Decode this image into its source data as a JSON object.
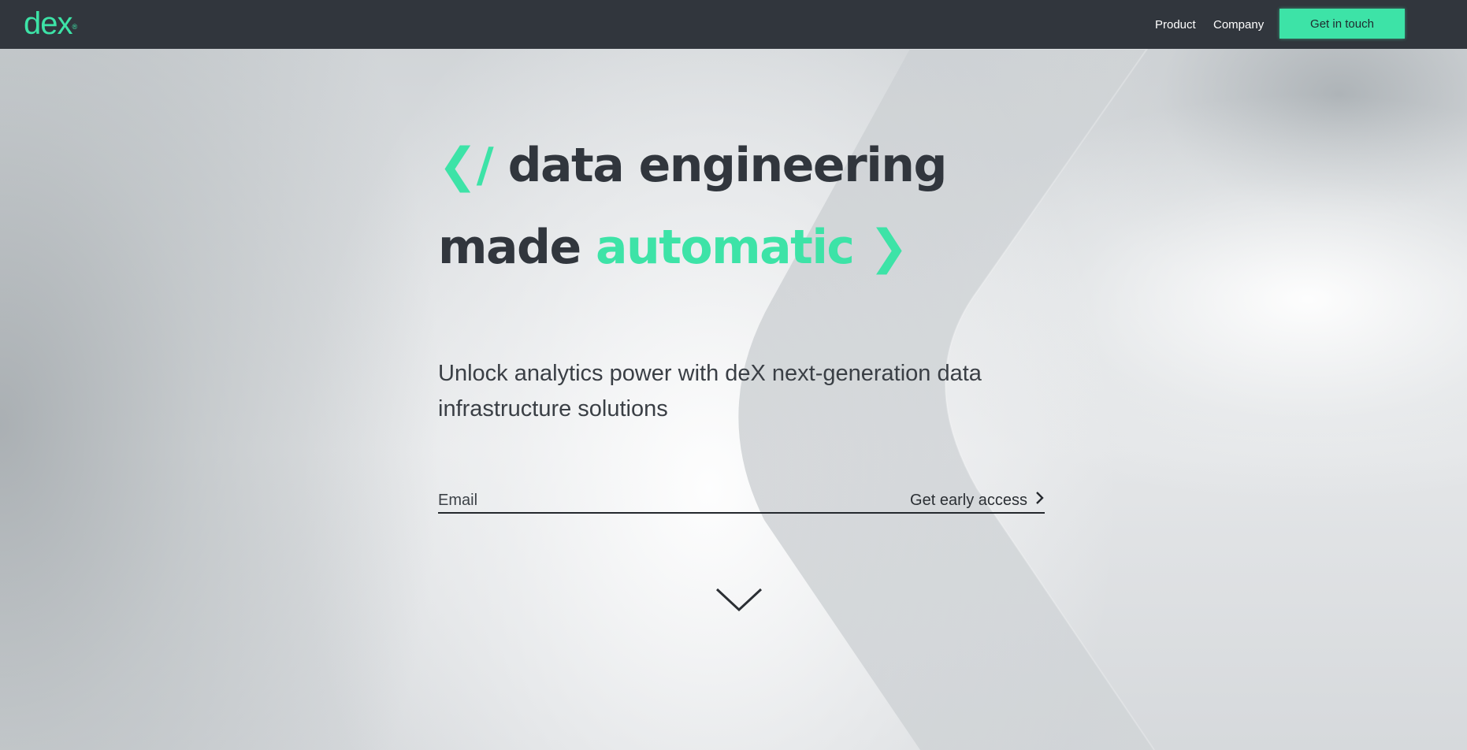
{
  "header": {
    "logo": "dex",
    "logo_mark": "®",
    "nav": [
      {
        "label": "Product"
      },
      {
        "label": "Company"
      }
    ],
    "cta_label": "Get in touch"
  },
  "hero": {
    "line1_open": "❮/",
    "line1_text": "data engineering",
    "line2_text": "made",
    "line2_accent": "automatic",
    "line2_close": "❯",
    "subtitle": "Unlock analytics power with deX next-generation data infrastructure solutions"
  },
  "form": {
    "email_placeholder": "Email",
    "submit_label": "Get early access"
  },
  "icons": {
    "submit": "chevron-right-icon",
    "scroll": "chevron-down-icon"
  },
  "colors": {
    "accent": "#3de3a7",
    "header_bg": "#31363d",
    "text_dark": "#31363d"
  }
}
